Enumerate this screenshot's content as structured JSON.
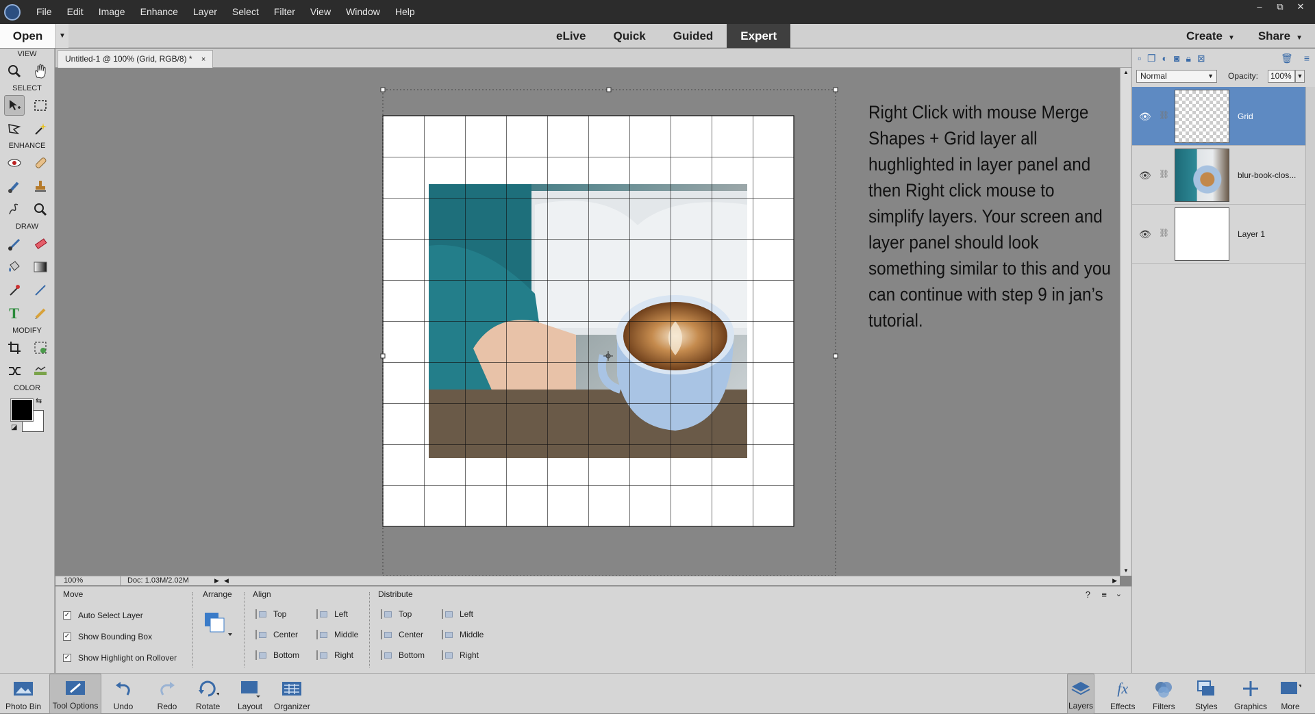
{
  "menu": [
    "File",
    "Edit",
    "Image",
    "Enhance",
    "Layer",
    "Select",
    "Filter",
    "View",
    "Window",
    "Help"
  ],
  "window_controls": [
    "–",
    "⧉",
    "✕"
  ],
  "open_button": "Open",
  "modes": [
    {
      "label": "eLive",
      "active": false
    },
    {
      "label": "Quick",
      "active": false
    },
    {
      "label": "Guided",
      "active": false
    },
    {
      "label": "Expert",
      "active": true
    }
  ],
  "create_label": "Create",
  "share_label": "Share",
  "toolbox": {
    "view": "VIEW",
    "select": "SELECT",
    "enhance": "ENHANCE",
    "draw": "DRAW",
    "modify": "MODIFY",
    "color": "COLOR"
  },
  "doc_tab": {
    "title": "Untitled-1 @ 100% (Grid, RGB/8) *",
    "close": "×"
  },
  "instructions": "Right Click with mouse Merge Shapes + Grid layer all hughlighted in layer panel and then Right click mouse to simplify layers. Your screen and layer panel should look something similar to this and you can continue with step 9 in jan’s tutorial.",
  "status": {
    "zoom": "100%",
    "doc_info": "Doc: 1.03M/2.02M"
  },
  "tool_options": {
    "move_title": "Move",
    "checkboxes": [
      {
        "label": "Auto Select Layer",
        "checked": true
      },
      {
        "label": "Show Bounding Box",
        "checked": true
      },
      {
        "label": "Show Highlight on Rollover",
        "checked": true
      }
    ],
    "arrange_title": "Arrange",
    "align_title": "Align",
    "align": [
      "Top",
      "Center",
      "Bottom",
      "Left",
      "Middle",
      "Right"
    ],
    "distribute_title": "Distribute",
    "distribute": [
      "Top",
      "Center",
      "Bottom",
      "Left",
      "Middle",
      "Right"
    ]
  },
  "layers_panel": {
    "blend_mode": "Normal",
    "opacity_label": "Opacity:",
    "opacity": "100%",
    "layers": [
      {
        "name": "Grid",
        "selected": true,
        "thumb": "checker"
      },
      {
        "name": "blur-book-clos...",
        "selected": false,
        "thumb": "photo"
      },
      {
        "name": "Layer 1",
        "selected": false,
        "thumb": "white"
      }
    ]
  },
  "taskbar_left": [
    "Photo Bin",
    "Tool Options",
    "Undo",
    "Redo",
    "Rotate",
    "Layout",
    "Organizer"
  ],
  "taskbar_right": [
    "Layers",
    "Effects",
    "Filters",
    "Styles",
    "Graphics",
    "More"
  ],
  "colors": {
    "accent": "#5e8ac2",
    "icon_blue": "#3a6ba8",
    "canvas_bg": "#868686"
  }
}
